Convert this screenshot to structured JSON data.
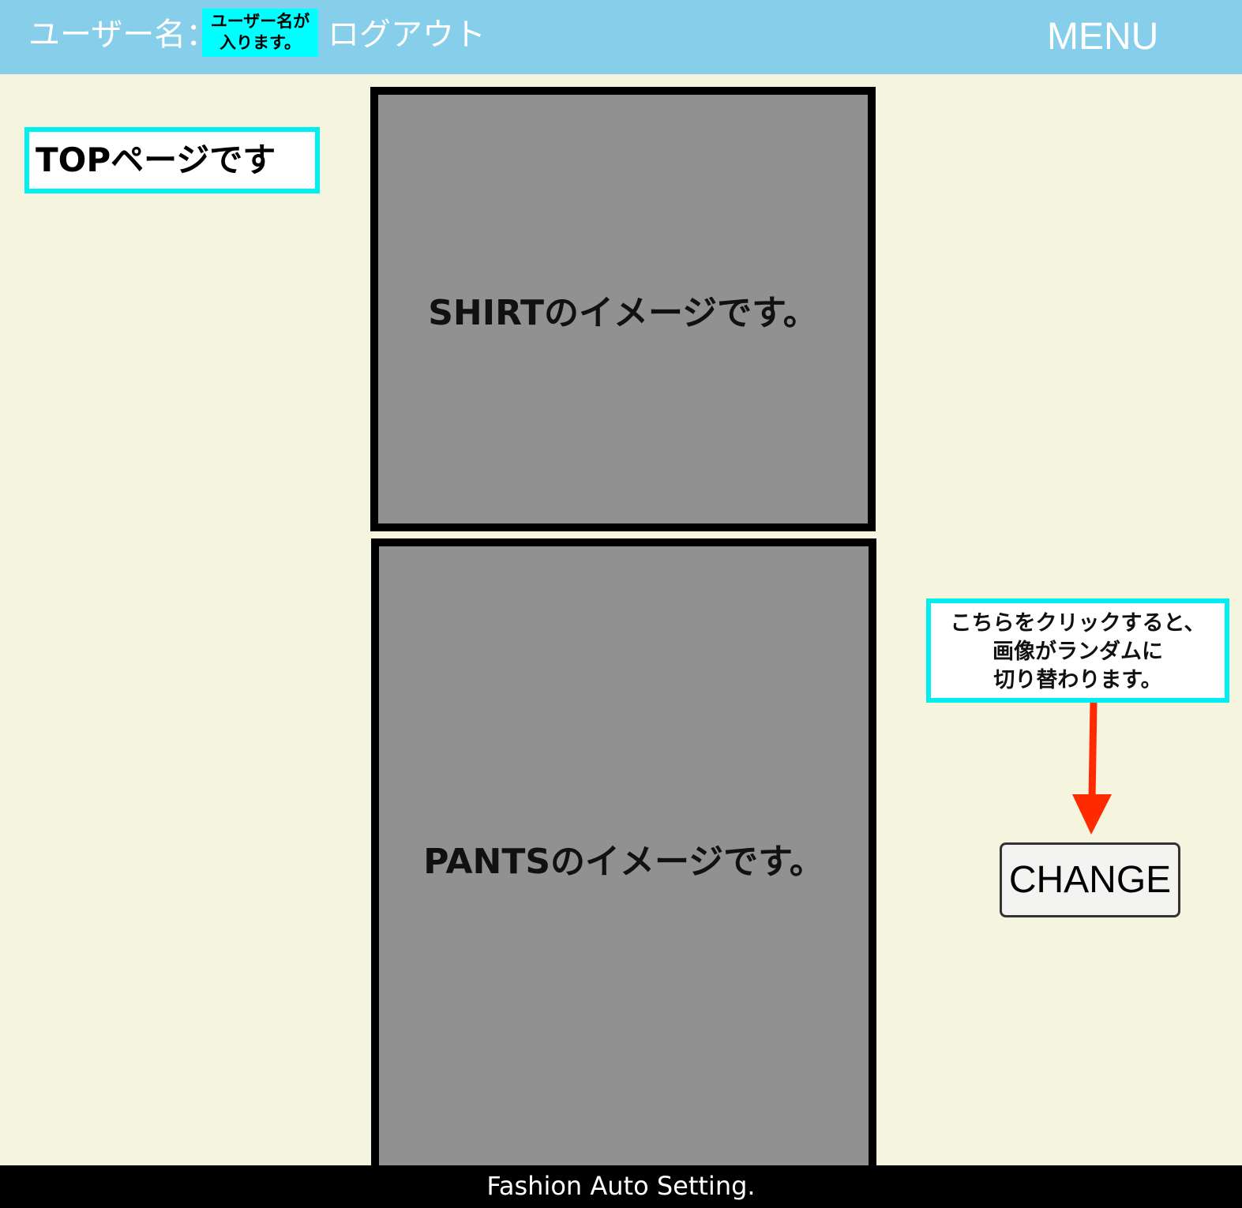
{
  "header": {
    "user_prefix": "ユーザー名：",
    "user_name_placeholder": "ユーザー名が\n入ります。",
    "logout_label": "ログアウト",
    "menu_label": "MENU"
  },
  "main": {
    "page_title": "TOPページです",
    "shirt_image_label": "SHIRTのイメージです。",
    "pants_image_label": "PANTSのイメージです。",
    "hint_text": "こちらをクリックすると、\n画像がランダムに\n切り替わります。",
    "change_button_label": "CHANGE"
  },
  "footer": {
    "text": "Fashion Auto Setting."
  },
  "colors": {
    "header_bg": "#87ceea",
    "page_bg": "#f5f4df",
    "highlight": "#00ffff",
    "image_placeholder": "#919191",
    "arrow": "#ff2a00",
    "footer_bg": "#000000"
  },
  "icons": {
    "arrow": "arrow-down-icon"
  }
}
